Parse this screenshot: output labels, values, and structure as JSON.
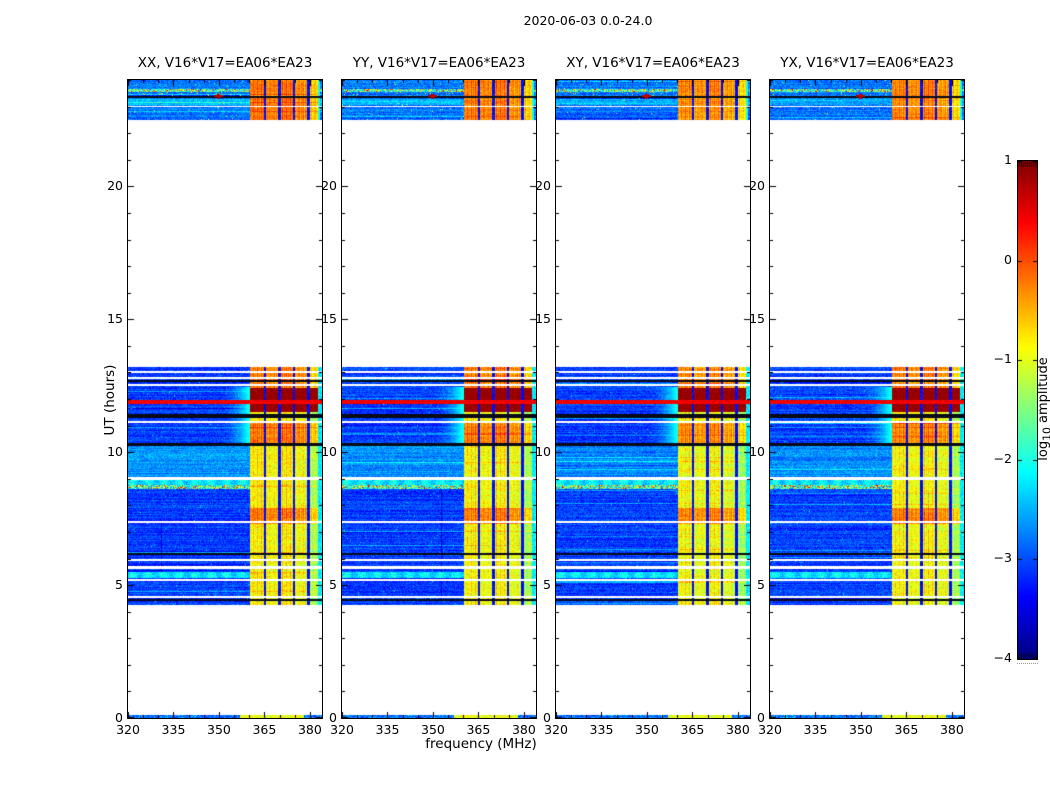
{
  "chart_data": {
    "type": "heatmap",
    "title": "2020-06-03 0.0-24.0",
    "xlabel": "frequency (MHz)",
    "ylabel": "UT (hours)",
    "x_axis": {
      "range_mhz": [
        320,
        384
      ],
      "major_ticks": [
        320,
        335,
        350,
        365,
        380
      ],
      "minor_step_mhz": 5
    },
    "y_axis": {
      "range_hours": [
        0,
        24
      ],
      "major_ticks": [
        0,
        5,
        10,
        15,
        20
      ],
      "minor_step_hours": 1
    },
    "colorbar": {
      "label_pre": "log",
      "label_sub": "10",
      "label_post": " amplitude",
      "vmin": -4,
      "vmax": 1,
      "tick_values": [
        1,
        0,
        -1,
        -2,
        -3,
        -4
      ],
      "tick_labels": [
        "1",
        "0",
        "−1",
        "−2",
        "−3",
        "−4"
      ],
      "colormap": "jet"
    },
    "panels": [
      {
        "title": "XX, V16*V17=EA06*EA23",
        "seed": 101,
        "gain": 1.0,
        "vline": {
          "mhz": 331.0,
          "ut": [
            5.2,
            7.4
          ]
        }
      },
      {
        "title": "YY, V16*V17=EA06*EA23",
        "seed": 202,
        "gain": 0.97,
        "vline": {
          "mhz": 352.8,
          "ut": [
            4.35,
            9.0
          ]
        }
      },
      {
        "title": "XY, V16*V17=EA06*EA23",
        "seed": 303,
        "gain": 0.9
      },
      {
        "title": "YX, V16*V17=EA06*EA23",
        "seed": 404,
        "gain": 0.94
      }
    ],
    "content": {
      "observing_blocks_ut": [
        [
          0,
          0.13
        ],
        [
          4.25,
          13.2
        ],
        [
          22.5,
          24
        ]
      ],
      "noise_floor_log10": -3.35,
      "rfi_band_mhz": [
        360.3,
        383.5
      ],
      "rfi_divider_mhz": [
        365.2,
        369.9,
        374.7,
        379.6
      ],
      "rfi_cyan_edge_mhz": [
        382.6,
        384
      ],
      "red_blocks_ut": [
        11.5,
        12.42
      ],
      "red_line_ut": [
        11.83,
        11.95
      ],
      "hot_band_rows_ut": [
        [
          12.42,
          13.2
        ],
        [
          10.35,
          11.1
        ],
        [
          7.3,
          7.9
        ],
        [
          22.5,
          24
        ]
      ],
      "white_stripes_ut": [
        [
          12.98,
          13.06
        ],
        [
          12.75,
          12.82
        ],
        [
          12.5,
          12.58
        ],
        [
          11.08,
          11.16
        ],
        [
          8.97,
          9.05
        ],
        [
          7.33,
          7.41
        ],
        [
          5.9,
          5.97
        ],
        [
          5.62,
          5.7
        ],
        [
          5.15,
          5.22
        ],
        [
          4.52,
          4.6
        ],
        [
          22.97,
          23.04
        ]
      ],
      "black_lines_ut": [
        [
          12.64,
          12.7
        ],
        [
          11.3,
          11.42
        ],
        [
          10.25,
          10.33
        ],
        [
          6.12,
          6.2
        ],
        [
          4.4,
          4.47
        ],
        [
          23.33,
          23.41
        ]
      ],
      "cyan_rows_ut": [
        [
          5.28,
          5.5
        ],
        [
          8.6,
          8.95
        ]
      ],
      "multicolor_rows_ut": [
        [
          23.56,
          23.68
        ],
        [
          8.62,
          8.76
        ]
      ],
      "bright_field_ut": [
        [
          8.6,
          10.25
        ]
      ],
      "cyan_glow": {
        "ut": [
          10.33,
          12.47
        ],
        "mhz_start": 350
      },
      "red_dot": {
        "mhz": 349.8,
        "ut": [
          23.3,
          23.48
        ]
      },
      "bottom_rfi_mhz": [
        357,
        378
      ]
    }
  }
}
